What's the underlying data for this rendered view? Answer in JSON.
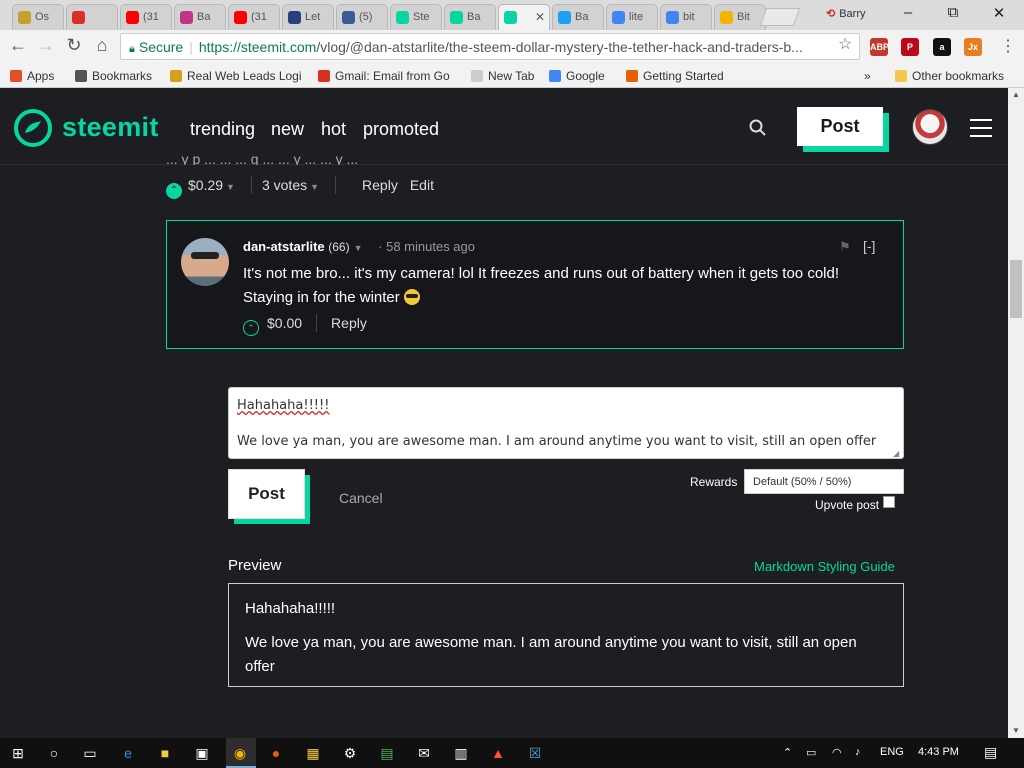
{
  "browser": {
    "tabs": [
      {
        "title": "Os",
        "favicon_color": "#c8a030"
      },
      {
        "title": "",
        "favicon_color": "#d93025"
      },
      {
        "title": "(31",
        "favicon_color": "#ff0000"
      },
      {
        "title": "Ba",
        "favicon_color": "#c13584"
      },
      {
        "title": "(31",
        "favicon_color": "#ff0000"
      },
      {
        "title": "Let",
        "favicon_color": "#2a3f7a"
      },
      {
        "title": "(5)",
        "favicon_color": "#3b5998"
      },
      {
        "title": "Ste",
        "favicon_color": "#07d6a0"
      },
      {
        "title": "Ba",
        "favicon_color": "#07d6a0"
      },
      {
        "title": "",
        "favicon_color": "#07d6a0",
        "active": true
      },
      {
        "title": "Ba",
        "favicon_color": "#1da1f2"
      },
      {
        "title": "lite",
        "favicon_color": "#4285f4"
      },
      {
        "title": "bit",
        "favicon_color": "#4285f4"
      },
      {
        "title": "Bit",
        "favicon_color": "#f4b400"
      }
    ],
    "profile_name": "Barry",
    "secure_label": "Secure",
    "url_host": "https://steemit.com",
    "url_path": "/vlog/@dan-atstarlite/the-steem-dollar-mystery-the-tether-hack-and-traders-b...",
    "extensions": [
      {
        "label": "ABP",
        "badge": "6",
        "color": "#c0392b"
      },
      {
        "label": "P",
        "color": "#bd081c"
      },
      {
        "label": "a",
        "badge": "5",
        "color": "#111111"
      },
      {
        "label": "Jx",
        "color": "#e67e22"
      }
    ],
    "bookmarks": [
      {
        "label": "Apps",
        "icon_color": "#e44d26"
      },
      {
        "label": "Bookmarks",
        "icon_color": "#555555"
      },
      {
        "label": "Real Web Leads Logi",
        "icon_color": "#d4a017"
      },
      {
        "label": "Gmail: Email from Go",
        "icon_color": "#d93025"
      },
      {
        "label": "New Tab",
        "icon_color": "#cccccc"
      },
      {
        "label": "Google",
        "icon_color": "#4285f4"
      },
      {
        "label": "Getting Started",
        "icon_color": "#e66000"
      }
    ],
    "more_bookmarks": "»",
    "other_bookmarks": "Other bookmarks"
  },
  "site": {
    "logo": "steemit",
    "nav": [
      "trending",
      "new",
      "hot",
      "promoted"
    ],
    "post_button": "Post",
    "accent_color": "#07d6a0"
  },
  "parent_comment": {
    "cut_text": "... y p ... ... ... g ... ... y ... ... y ...",
    "payout": "$0.29",
    "votes": "3 votes",
    "reply": "Reply",
    "edit": "Edit"
  },
  "comment": {
    "author": "dan-atstarlite",
    "reputation": "(66)",
    "time": "· 58 minutes ago",
    "collapse": "[-]",
    "body": "It's not me bro... it's my camera! lol It freezes and runs out of battery when it gets too cold! Staying in for the winter",
    "payout": "$0.00",
    "reply": "Reply"
  },
  "editor": {
    "line1": "Hahahaha!!!!!",
    "line2": "We love ya man, you are awesome man.   I am around anytime you want to visit, still an open offer",
    "post": "Post",
    "cancel": "Cancel",
    "rewards_label": "Rewards",
    "rewards_value": "Default (50% / 50%)",
    "upvote_label": "Upvote post",
    "upvote_checked": false
  },
  "preview": {
    "label": "Preview",
    "guide_link": "Markdown Styling Guide",
    "line1": "Hahahaha!!!!!",
    "line2": "We love ya man, you are awesome man. I am around anytime you want to visit, still an open offer"
  },
  "taskbar": {
    "language": "ENG",
    "time": "4:43 PM"
  }
}
